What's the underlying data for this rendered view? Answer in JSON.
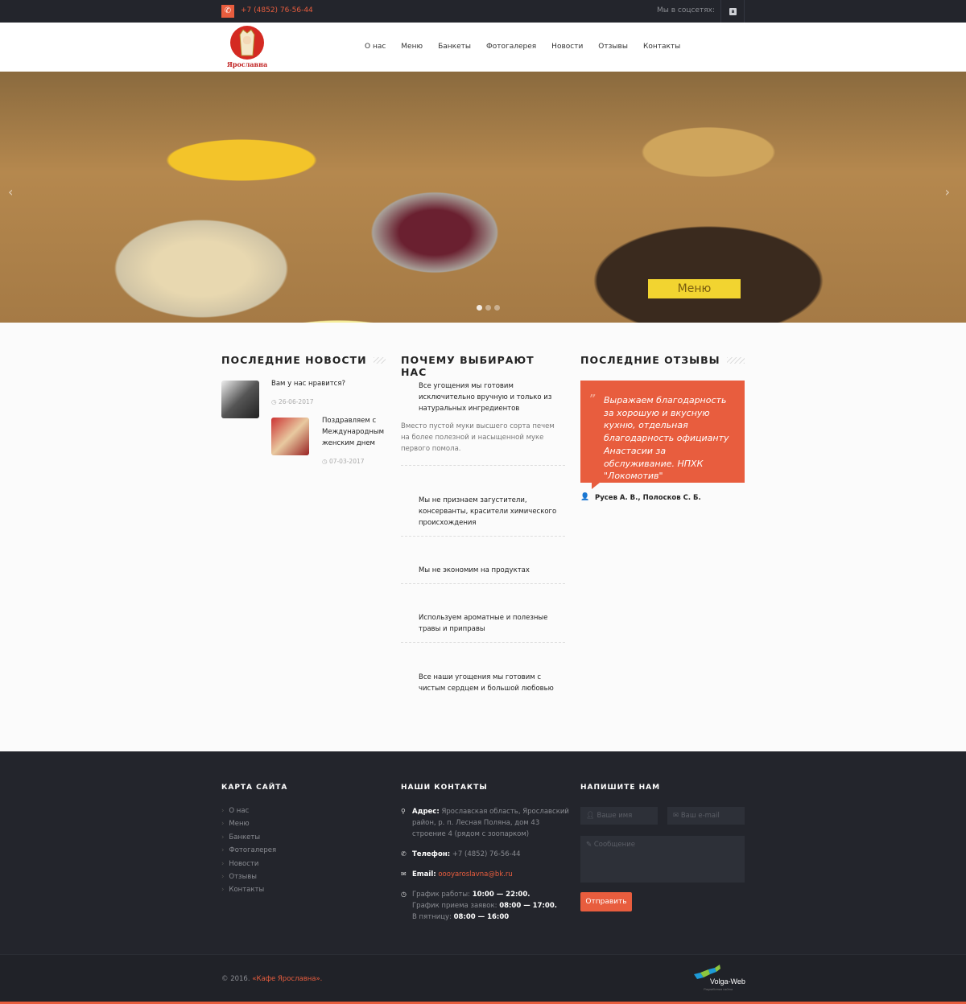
{
  "topbar": {
    "phone": "+7 (4852) 76-56-44",
    "social_label": "Мы в соцсетях:",
    "vk": "в"
  },
  "logo": {
    "text": "Ярославна"
  },
  "nav": [
    "О нас",
    "Меню",
    "Банкеты",
    "Фотогалерея",
    "Новости",
    "Отзывы",
    "Контакты"
  ],
  "hero": {
    "button": "Меню",
    "slides": 3,
    "active_slide": 1
  },
  "news": {
    "title": "ПОСЛЕДНИЕ НОВОСТИ",
    "items": [
      {
        "title": "Вам у нас нравится?",
        "date": "26-06-2017"
      },
      {
        "title": "Поздравляем с Международным женским днем",
        "date": "07-03-2017"
      }
    ]
  },
  "why": {
    "title": "ПОЧЕМУ ВЫБИРАЮТ НАС",
    "items": [
      {
        "title": "Все угощения мы готовим исключительно вручную и только из натуральных ингредиентов",
        "text": "Вместо пустой муки высшего сорта печем на более полезной и насыщенной муке первого помола."
      },
      {
        "title": "Мы не признаем загустители, консерванты, красители химического происхождения"
      },
      {
        "title": "Мы не экономим на продуктах"
      },
      {
        "title": "Используем ароматные и полезные травы и приправы"
      },
      {
        "title": "Все наши угощения мы готовим с чистым сердцем и большой любовью"
      }
    ]
  },
  "reviews": {
    "title": "ПОСЛЕДНИЕ ОТЗЫВЫ",
    "text": "Выражаем благодарность за хорошую и вкусную кухню, отдельная благодарность официанту Анастасии за обслуживание. НПХК \"Локомотив\"",
    "author": "Русев А. В., Полосков С. Б."
  },
  "footer": {
    "sitemap": {
      "title": "КАРТА САЙТА",
      "links": [
        "О нас",
        "Меню",
        "Банкеты",
        "Фотогалерея",
        "Новости",
        "Отзывы",
        "Контакты"
      ]
    },
    "contacts": {
      "title": "НАШИ КОНТАКТЫ",
      "address_label": "Адрес:",
      "address": "Ярославская область, Ярославский район, р. п. Лесная Поляна, дом 43 строение 4 (рядом с зоопарком)",
      "phone_label": "Телефон:",
      "phone": "+7 (4852) 76-56-44",
      "email_label": "Email:",
      "email": "oooyaroslavna@bk.ru",
      "hours": [
        {
          "label": "График работы:",
          "value": "10:00 — 22:00."
        },
        {
          "label": "График приема заявок:",
          "value": "08:00 — 17:00."
        },
        {
          "label": "В пятницу:",
          "value": "08:00 — 16:00"
        }
      ]
    },
    "form": {
      "title": "НАПИШИТЕ НАМ",
      "name_placeholder": "Ваше имя",
      "email_placeholder": "Ваш e-mail",
      "message_placeholder": "Сообщение",
      "send": "Отправить"
    },
    "copyright_prefix": "© 2016. ",
    "copyright_name": "«Кафе Ярославна».",
    "dev": {
      "name": "Volga-Web",
      "tagline": "Разработка сайта"
    }
  },
  "colors": {
    "accent": "#e85d3e",
    "dark": "#23252c",
    "hero_button": "#f2d430"
  }
}
